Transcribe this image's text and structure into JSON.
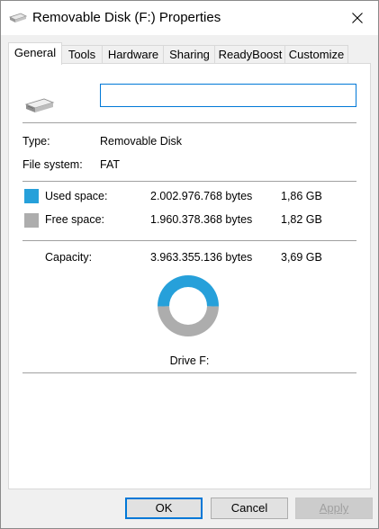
{
  "window": {
    "title": "Removable Disk (F:) Properties"
  },
  "tabs": [
    {
      "label": "General",
      "active": true
    },
    {
      "label": "Tools"
    },
    {
      "label": "Hardware"
    },
    {
      "label": "Sharing"
    },
    {
      "label": "ReadyBoost"
    },
    {
      "label": "Customize"
    }
  ],
  "general": {
    "name_value": "",
    "type_label": "Type:",
    "type_value": "Removable Disk",
    "fs_label": "File system:",
    "fs_value": "FAT",
    "used": {
      "label": "Used space:",
      "bytes": "2.002.976.768 bytes",
      "size": "1,86 GB",
      "color": "#26a0da"
    },
    "free": {
      "label": "Free space:",
      "bytes": "1.960.378.368 bytes",
      "size": "1,82 GB",
      "color": "#adadad"
    },
    "capacity": {
      "label": "Capacity:",
      "bytes": "3.963.355.136 bytes",
      "size": "3,69 GB"
    },
    "used_fraction": 0.5054,
    "drive_caption": "Drive F:"
  },
  "buttons": {
    "ok": "OK",
    "cancel": "Cancel",
    "apply": "Apply"
  }
}
